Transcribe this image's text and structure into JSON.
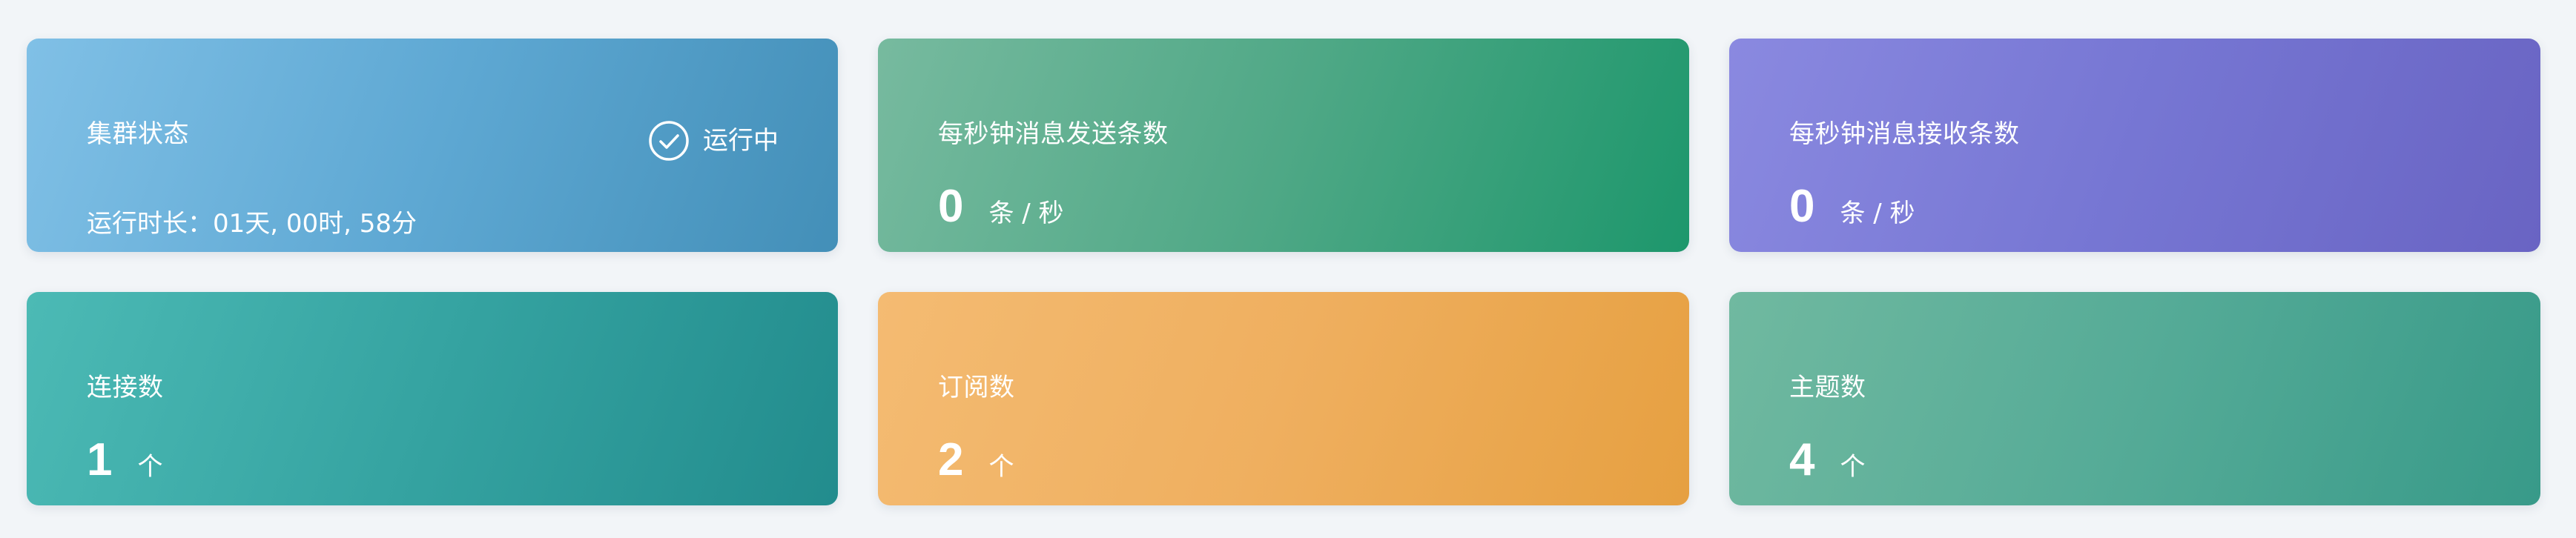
{
  "cluster": {
    "title": "集群状态",
    "status": "运行中",
    "status_icon": "check-circle-icon",
    "uptime": "运行时长：01天, 00时, 58分"
  },
  "send_rate": {
    "title": "每秒钟消息发送条数",
    "value": "0",
    "unit": "条 / 秒"
  },
  "recv_rate": {
    "title": "每秒钟消息接收条数",
    "value": "0",
    "unit": "条 / 秒"
  },
  "connections": {
    "title": "连接数",
    "value": "1",
    "unit": "个"
  },
  "subscriptions": {
    "title": "订阅数",
    "value": "2",
    "unit": "个"
  },
  "topics": {
    "title": "主题数",
    "value": "4",
    "unit": "个"
  },
  "colors": {
    "page_background": "#f2f5f8",
    "cluster": [
      "#80c0e6",
      "#438fb8"
    ],
    "send_rate": [
      "#77ba9f",
      "#1d976c"
    ],
    "recv_rate": [
      "#8a89e0",
      "#6964c3"
    ],
    "connections": [
      "#4cbab5",
      "#228c8d"
    ],
    "subscriptions": [
      "#f4bb72",
      "#e6a041"
    ],
    "topics": [
      "#70b9a0",
      "#389a89"
    ]
  }
}
